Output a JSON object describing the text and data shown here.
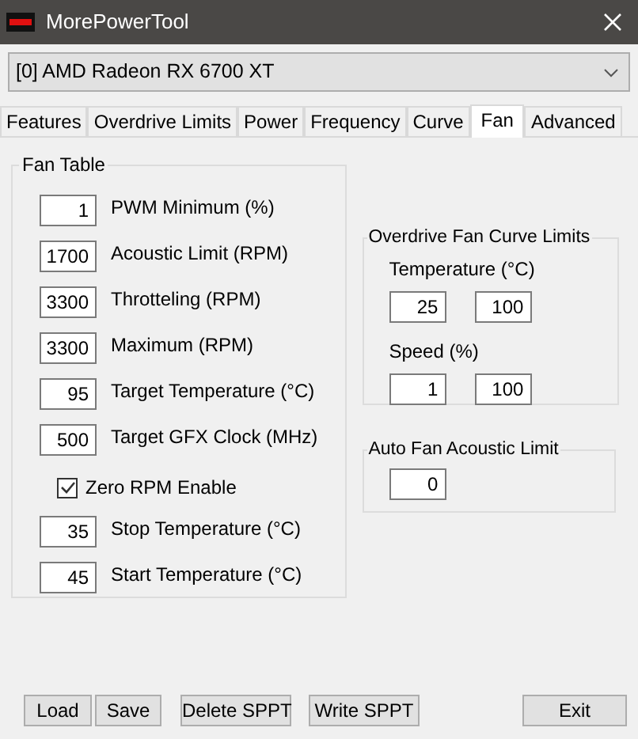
{
  "window": {
    "title": "MorePowerTool"
  },
  "device_select": {
    "value": "[0] AMD Radeon RX 6700 XT"
  },
  "tabs": [
    {
      "label": "Features",
      "selected": false
    },
    {
      "label": "Overdrive Limits",
      "selected": false
    },
    {
      "label": "Power",
      "selected": false
    },
    {
      "label": "Frequency",
      "selected": false
    },
    {
      "label": "Curve",
      "selected": false
    },
    {
      "label": "Fan",
      "selected": true
    },
    {
      "label": "Advanced",
      "selected": false
    }
  ],
  "fan_table": {
    "title": "Fan Table",
    "items": [
      {
        "kind": "field",
        "value": "1",
        "label": "PWM Minimum (%)"
      },
      {
        "kind": "field",
        "value": "1700",
        "label": "Acoustic Limit (RPM)"
      },
      {
        "kind": "field",
        "value": "3300",
        "label": "Throtteling (RPM)"
      },
      {
        "kind": "field",
        "value": "3300",
        "label": "Maximum (RPM)"
      },
      {
        "kind": "field",
        "value": "95",
        "label": "Target Temperature (°C)"
      },
      {
        "kind": "field",
        "value": "500",
        "label": "Target GFX Clock (MHz)"
      },
      {
        "kind": "checkbox",
        "label": "Zero RPM Enable",
        "checked": true
      },
      {
        "kind": "field",
        "value": "35",
        "label": "Stop Temperature (°C)"
      },
      {
        "kind": "field",
        "value": "45",
        "label": "Start Temperature (°C)"
      }
    ]
  },
  "fan_curve_limits": {
    "title": "Overdrive Fan Curve Limits",
    "groups": [
      {
        "label": "Temperature (°C)",
        "min": "25",
        "max": "100"
      },
      {
        "label": "Speed (%)",
        "min": "1",
        "max": "100"
      }
    ]
  },
  "auto_fan_acoustic_limit": {
    "title": "Auto Fan Acoustic Limit",
    "value": "0"
  },
  "buttons": [
    {
      "label": "Load"
    },
    {
      "label": "Save"
    },
    {
      "label": "Delete SPPT"
    },
    {
      "label": "Write SPPT"
    },
    {
      "label": "Exit"
    }
  ]
}
